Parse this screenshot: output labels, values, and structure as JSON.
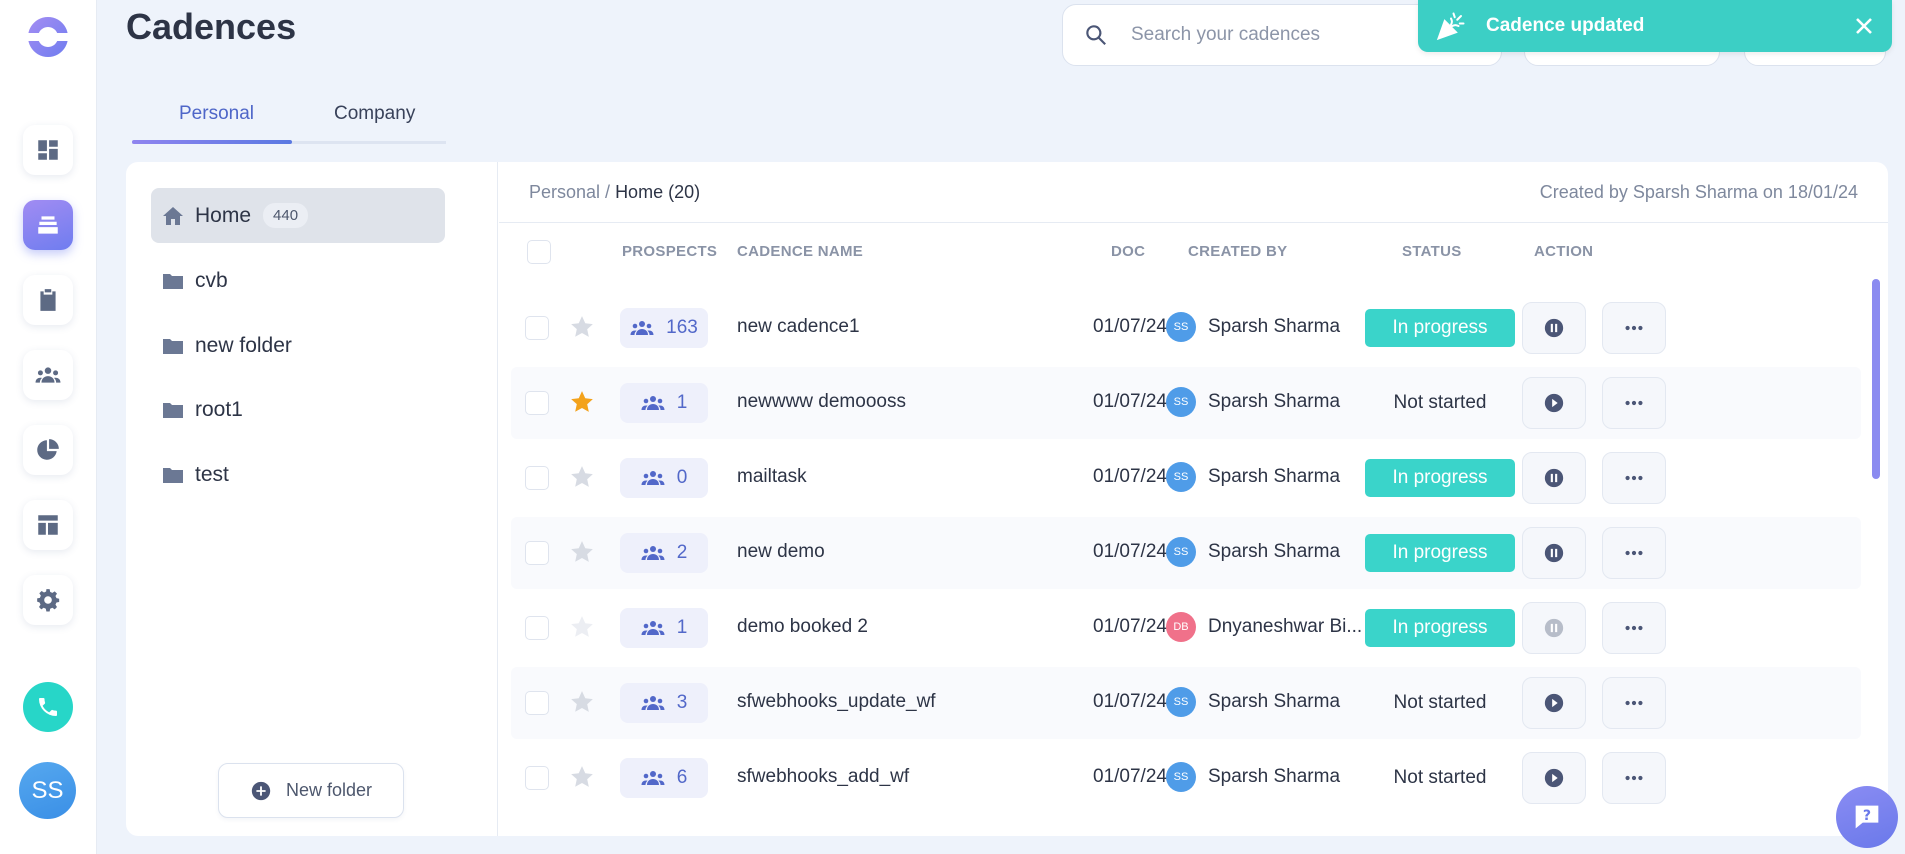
{
  "header": {
    "title": "Cadences",
    "search_placeholder": "Search your cadences"
  },
  "toast": {
    "message": "Cadence updated"
  },
  "tabs": [
    {
      "label": "Personal"
    },
    {
      "label": "Company"
    }
  ],
  "folders": [
    {
      "label": "Home",
      "count": "440"
    },
    {
      "label": "cvb"
    },
    {
      "label": "new folder"
    },
    {
      "label": "root1"
    },
    {
      "label": "test"
    }
  ],
  "new_folder_label": "New folder",
  "breadcrumb": {
    "parent": "Personal /",
    "current": "Home (20)"
  },
  "created_info": "Created by Sparsh Sharma on 18/01/24",
  "table": {
    "headers": {
      "prospects": "PROSPECTS",
      "name": "CADENCE NAME",
      "doc": "DOC",
      "created_by": "CREATED BY",
      "status": "STATUS",
      "action": "ACTION"
    },
    "rows": [
      {
        "starred": false,
        "prospects": "163",
        "name": "new cadence1",
        "doc": "01/07/24",
        "initials": "SS",
        "creator": "Sparsh Sharma",
        "status": "In progress"
      },
      {
        "starred": true,
        "prospects": "1",
        "name": "newwww demoooss",
        "doc": "01/07/24",
        "initials": "SS",
        "creator": "Sparsh Sharma",
        "status": "Not started"
      },
      {
        "starred": false,
        "prospects": "0",
        "name": "mailtask",
        "doc": "01/07/24",
        "initials": "SS",
        "creator": "Sparsh Sharma",
        "status": "In progress"
      },
      {
        "starred": false,
        "prospects": "2",
        "name": "new demo",
        "doc": "01/07/24",
        "initials": "SS",
        "creator": "Sparsh Sharma",
        "status": "In progress"
      },
      {
        "starred": false,
        "prospects": "1",
        "name": "demo booked 2",
        "doc": "01/07/24",
        "initials": "DB",
        "creator": "Dnyaneshwar Bi...",
        "status": "In progress"
      },
      {
        "starred": false,
        "prospects": "3",
        "name": "sfwebhooks_update_wf",
        "doc": "01/07/24",
        "initials": "SS",
        "creator": "Sparsh Sharma",
        "status": "Not started"
      },
      {
        "starred": false,
        "prospects": "6",
        "name": "sfwebhooks_add_wf",
        "doc": "01/07/24",
        "initials": "SS",
        "creator": "Sparsh Sharma",
        "status": "Not started"
      }
    ]
  },
  "user_initials": "SS",
  "colors": {
    "accent": "#5268c9",
    "in_progress": "#3ad4ca",
    "toast": "#3ccfc5",
    "star_on": "#f3a21c"
  }
}
